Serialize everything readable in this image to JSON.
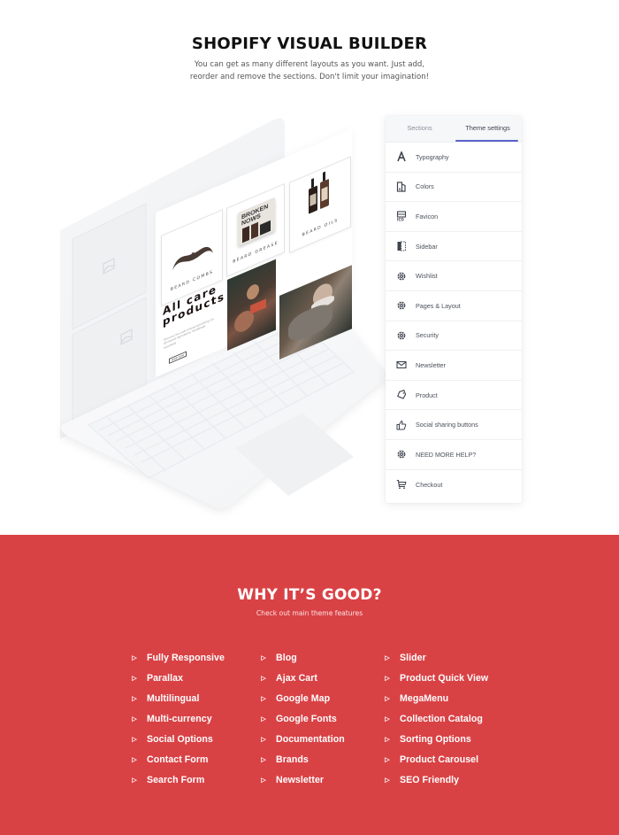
{
  "header": {
    "title": "SHOPIFY VISUAL BUILDER",
    "subtitle_line1": "You can get as many different layouts as you want. Just add,",
    "subtitle_line2": "reorder and remove the sections. Don't limit your imagination!"
  },
  "mockup": {
    "products": [
      {
        "label": "BEARD COMBS"
      },
      {
        "label": "BEARD GREASE"
      },
      {
        "label": "BEARD OILS"
      }
    ],
    "grease_brand": "BROKEN NOWS",
    "promo_title_line1": "All care",
    "promo_title_line2": "products",
    "promo_text": "Discover the craft of beard grooming via all-natural ingredients, handmade essentials",
    "promo_button": "SHOP NOW"
  },
  "panel": {
    "tabs": [
      {
        "label": "Sections",
        "active": false
      },
      {
        "label": "Theme settings",
        "active": true
      }
    ],
    "accent_color": "#5b62c9",
    "items": [
      {
        "label": "Typography",
        "icon": "typography-icon"
      },
      {
        "label": "Colors",
        "icon": "colors-icon"
      },
      {
        "label": "Favicon",
        "icon": "favicon-icon"
      },
      {
        "label": "Sidebar",
        "icon": "sidebar-icon"
      },
      {
        "label": "Wishlist",
        "icon": "gear-icon"
      },
      {
        "label": "Pages & Layout",
        "icon": "gear-icon"
      },
      {
        "label": "Security",
        "icon": "gear-icon"
      },
      {
        "label": "Newsletter",
        "icon": "envelope-icon"
      },
      {
        "label": "Product",
        "icon": "tag-icon"
      },
      {
        "label": "Social sharing buttons",
        "icon": "thumbs-up-icon"
      },
      {
        "label": "NEED MORE HELP?",
        "icon": "gear-icon"
      },
      {
        "label": "Checkout",
        "icon": "cart-icon"
      }
    ]
  },
  "features": {
    "title": "WHY IT’S GOOD?",
    "subtitle": "Check out main theme features",
    "background_color": "#d94245",
    "bullet": "▷",
    "columns": [
      [
        "Fully Responsive",
        "Parallax",
        "Multilingual",
        "Multi-currency",
        "Social Options",
        "Contact Form",
        "Search Form"
      ],
      [
        "Blog",
        "Ajax Cart",
        "Google Map",
        "Google Fonts",
        "Documentation",
        "Brands",
        "Newsletter"
      ],
      [
        "Slider",
        "Product Quick View",
        "MegaMenu",
        "Collection Catalog",
        "Sorting Options",
        "Product Carousel",
        "SEO Friendly"
      ]
    ]
  }
}
